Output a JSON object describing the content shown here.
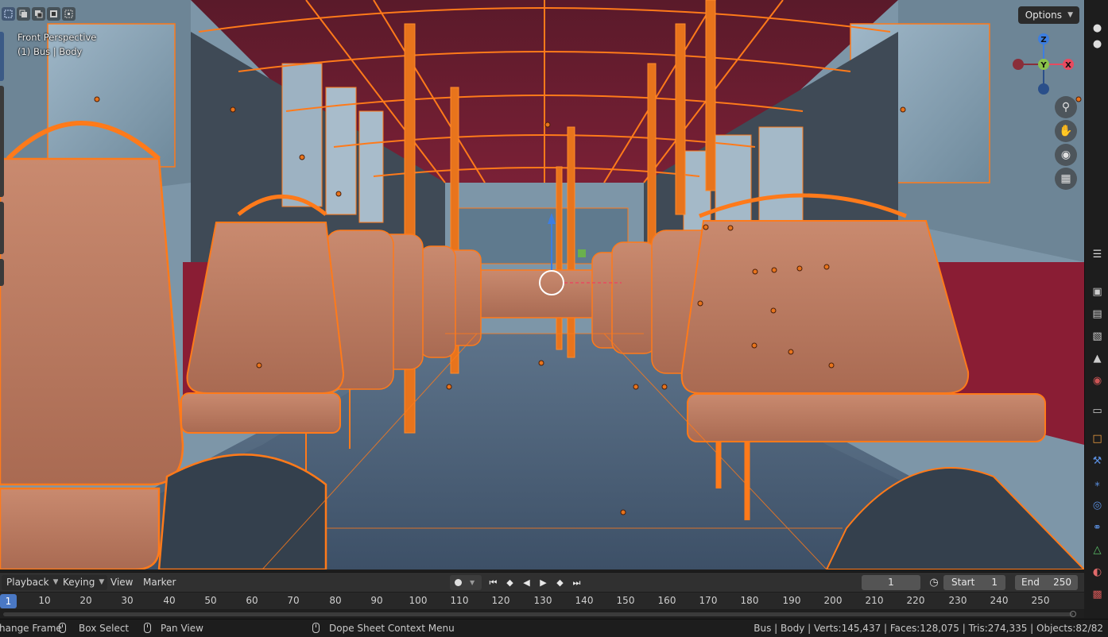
{
  "viewport": {
    "perspective_label": "Front Perspective",
    "object_label": "(1) Bus | Body",
    "options_label": "Options",
    "gizmo": {
      "z": "Z",
      "y": "Y",
      "x": "X"
    },
    "colors": {
      "accent": "#ff7a1a",
      "gizmo_x": "#e84a5f",
      "gizmo_y": "#8bc34a",
      "gizmo_z": "#3d7ee0"
    }
  },
  "timeline": {
    "menus": [
      "Playback",
      "Keying",
      "View",
      "Marker"
    ],
    "current_frame": "1",
    "start_label": "Start",
    "start_value": "1",
    "end_label": "End",
    "end_value": "250",
    "ruler_current": "1",
    "ruler_ticks": [
      "10",
      "20",
      "30",
      "40",
      "50",
      "60",
      "70",
      "80",
      "90",
      "100",
      "110",
      "120",
      "130",
      "140",
      "150",
      "160",
      "170",
      "180",
      "190",
      "200",
      "210",
      "220",
      "230",
      "240",
      "250"
    ]
  },
  "statusbar": {
    "left1": "hange Frame",
    "left2": "Box Select",
    "left3": "Pan View",
    "left4": "Dope Sheet Context Menu",
    "stats": "Bus | Body | Verts:145,437 | Faces:128,075 | Tris:274,335 | Objects:82/82"
  }
}
